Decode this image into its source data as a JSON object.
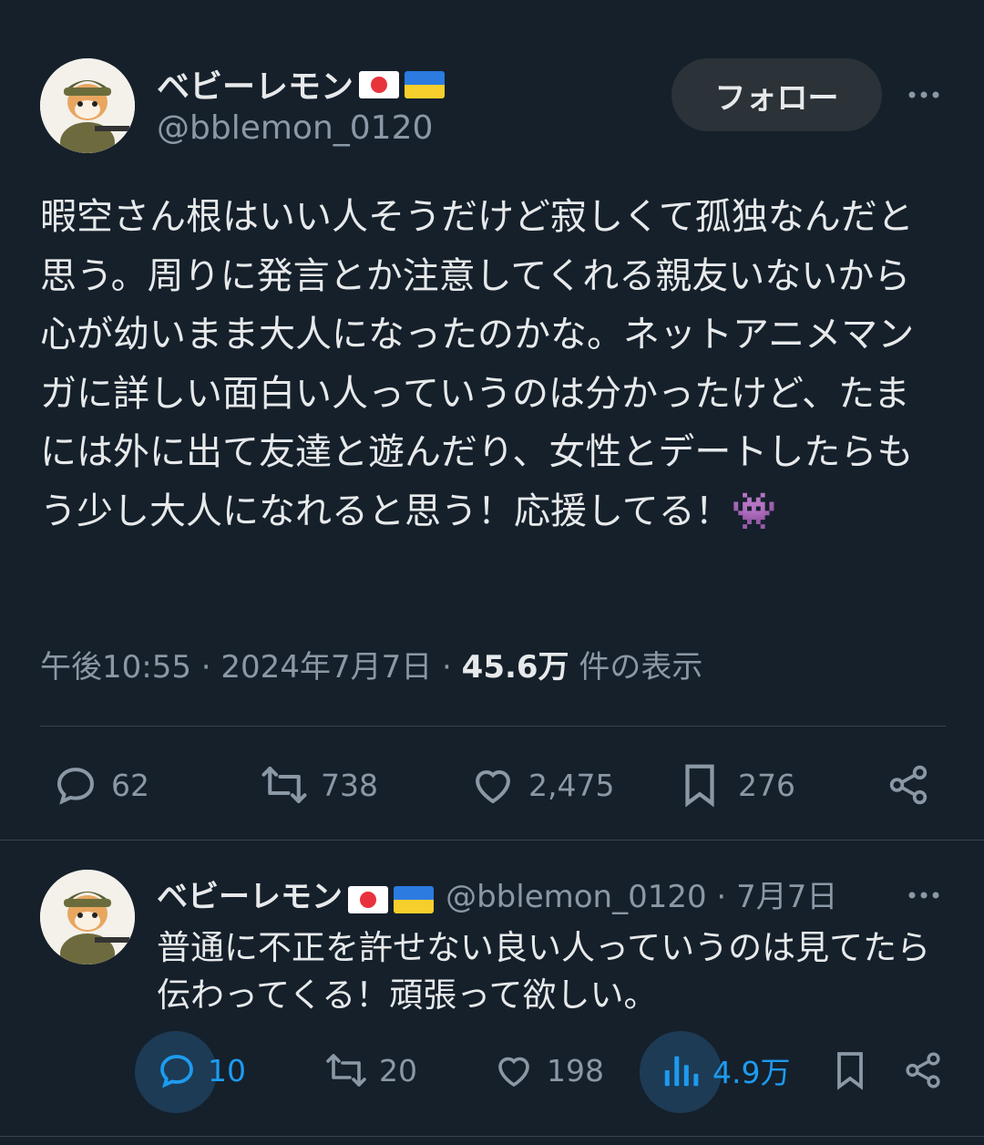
{
  "tweet": {
    "display_name": "ベビーレモン",
    "handle": "@bblemon_0120",
    "follow_label": "フォロー",
    "text": "暇空さん根はいい人そうだけど寂しくて孤独なんだと思う。周りに発言とか注意してくれる親友いないから心が幼いまま大人になったのかな。ネットアニメマンガに詳しい面白い人っていうのは分かったけど、たまには外に出て友達と遊んだり、女性とデートしたらもう少し大人になれると思う！応援してる！👾",
    "time": "午後10:55",
    "date": "2024年7月7日",
    "views_count": "45.6万",
    "views_label": "件の表示",
    "replies": "62",
    "retweets": "738",
    "likes": "2,475",
    "bookmarks": "276"
  },
  "reply": {
    "display_name": "ベビーレモン",
    "handle": "@bblemon_0120",
    "date": "7月7日",
    "text": "普通に不正を許せない良い人っていうのは見てたら伝わってくる！頑張って欲しい。",
    "replies": "10",
    "retweets": "20",
    "likes": "198",
    "views": "4.9万"
  },
  "colors": {
    "background": "#15202b",
    "text": "#e7e9ea",
    "muted": "#8b98a5",
    "accent": "#1d9bf0"
  },
  "icons": [
    "avatar-shiba-soldier",
    "japan-flag",
    "ukraine-flag",
    "more-icon",
    "reply-icon",
    "retweet-icon",
    "like-icon",
    "bookmark-icon",
    "share-icon",
    "views-icon"
  ]
}
